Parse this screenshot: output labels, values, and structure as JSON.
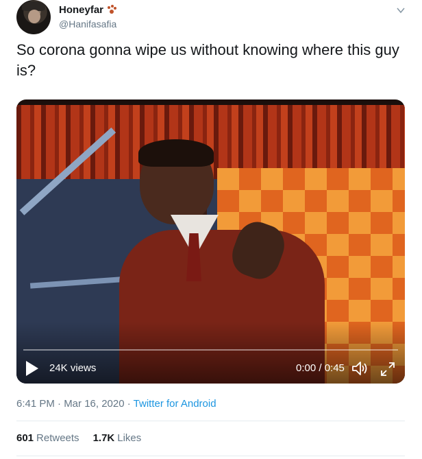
{
  "author": {
    "display_name": "Honeyfar",
    "handle": "@Hanifasafia",
    "badge_icon": "paw-prints-icon"
  },
  "tweet": {
    "text": "So corona gonna wipe us without knowing where this guy is?"
  },
  "video": {
    "views": "24K views",
    "time": "0:00 / 0:45",
    "progress": 0
  },
  "meta": {
    "timestamp": "6:41 PM · Mar 16, 2020",
    "separator": " · ",
    "source": "Twitter for Android"
  },
  "stats": {
    "retweets_count": "601",
    "retweets_label": "Retweets",
    "likes_count": "1.7K",
    "likes_label": "Likes"
  },
  "colors": {
    "link": "#1b95e0",
    "secondary_text": "#657786"
  }
}
